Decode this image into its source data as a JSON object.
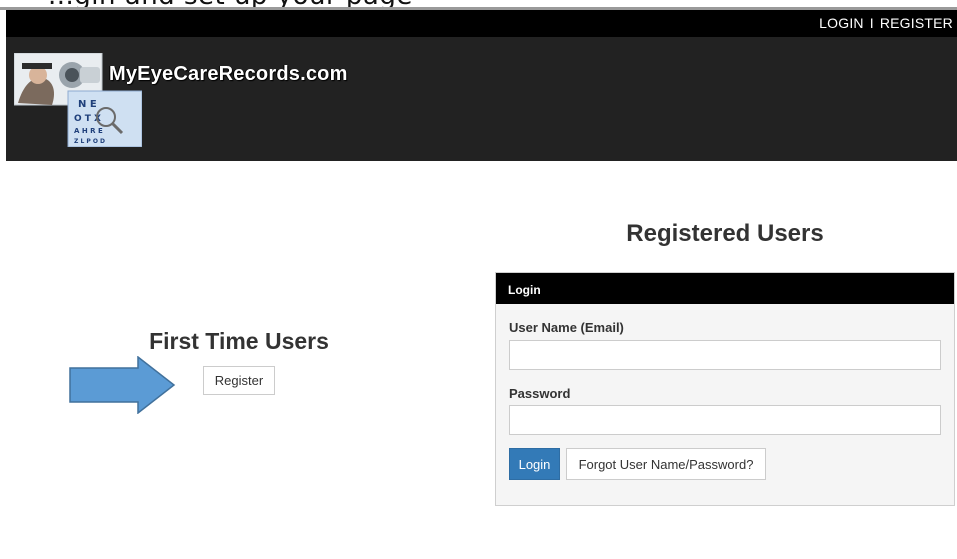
{
  "top_cutoff_text": "...gin and set up your page",
  "header": {
    "auth_links": {
      "login": "LOGIN",
      "separator": "I",
      "register": "REGISTER"
    },
    "site_title": "MyEyeCareRecords.com",
    "logo_icon": "eye-exam-photo-icon"
  },
  "first_time": {
    "title": "First Time Users",
    "register_button": "Register",
    "arrow_icon": "right-arrow-icon",
    "arrow_color": "#5b9bd5"
  },
  "registered": {
    "title": "Registered Users",
    "panel_heading": "Login",
    "username_label": "User Name (Email)",
    "username_value": "",
    "password_label": "Password",
    "password_value": "",
    "login_button": "Login",
    "forgot_button": "Forgot User Name/Password?"
  },
  "colors": {
    "header_bar": "#000000",
    "banner": "#222222",
    "primary_button": "#337ab7",
    "panel_background": "#f5f5f5"
  }
}
